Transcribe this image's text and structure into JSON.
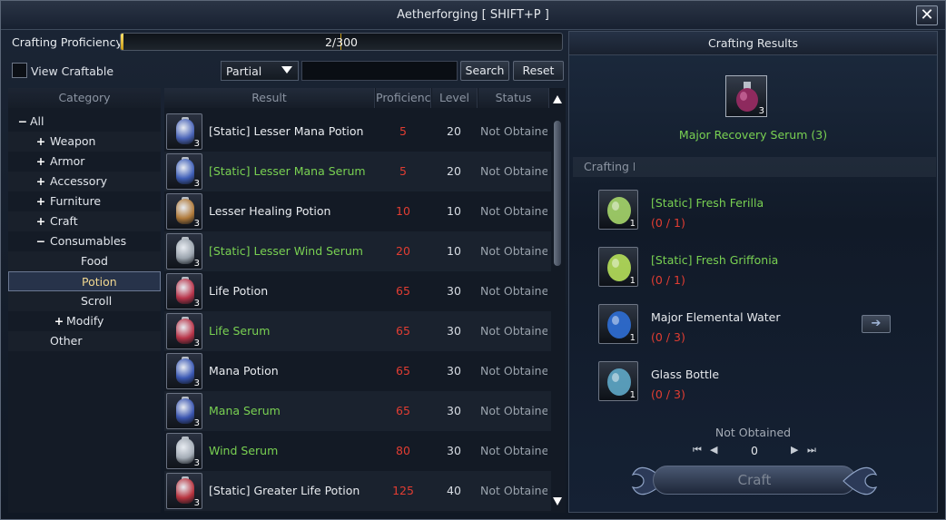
{
  "window": {
    "title": "Aetherforging [ SHIFT+P ]"
  },
  "proficiency": {
    "label": "Crafting Proficiency",
    "text": "2/300",
    "fraction": 0.0067
  },
  "filters": {
    "view_craftable_label": "View Craftable",
    "match_mode": "Partial",
    "search_placeholder": "",
    "search_button": "Search",
    "reset_button": "Reset"
  },
  "category": {
    "header": "Category",
    "items": [
      {
        "label": "All",
        "sign": "−"
      },
      {
        "label": "Weapon",
        "sign": "+"
      },
      {
        "label": "Armor",
        "sign": "+"
      },
      {
        "label": "Accessory",
        "sign": "+"
      },
      {
        "label": "Furniture",
        "sign": "+"
      },
      {
        "label": "Craft",
        "sign": "+"
      },
      {
        "label": "Consumables",
        "sign": "−"
      },
      {
        "label": "Food",
        "sign": ""
      },
      {
        "label": "Potion",
        "sign": ""
      },
      {
        "label": "Scroll",
        "sign": ""
      },
      {
        "label": "Modify",
        "sign": "+"
      },
      {
        "label": "Other",
        "sign": ""
      }
    ]
  },
  "list": {
    "headers": {
      "result": "Result",
      "proficiency": "Proficiency",
      "level": "Level",
      "status": "Status"
    },
    "rows": [
      {
        "name": "[Static] Lesser Mana Potion",
        "color": "white",
        "proficiency": "5",
        "level": "20",
        "status": "Not Obtained",
        "qty": "3",
        "potion": "#4a64b8"
      },
      {
        "name": "[Static] Lesser Mana Serum",
        "color": "green",
        "proficiency": "5",
        "level": "20",
        "status": "Not Obtained",
        "qty": "3",
        "potion": "#3f5fb8"
      },
      {
        "name": "Lesser Healing Potion",
        "color": "white",
        "proficiency": "10",
        "level": "10",
        "status": "Not Obtained",
        "qty": "3",
        "potion": "#b07a3a"
      },
      {
        "name": "[Static] Lesser Wind Serum",
        "color": "green",
        "proficiency": "20",
        "level": "10",
        "status": "Not Obtained",
        "qty": "3",
        "potion": "#9aa3ad"
      },
      {
        "name": "Life Potion",
        "color": "white",
        "proficiency": "65",
        "level": "30",
        "status": "Not Obtained",
        "qty": "3",
        "potion": "#b8344a"
      },
      {
        "name": "Life Serum",
        "color": "green",
        "proficiency": "65",
        "level": "30",
        "status": "Not Obtained",
        "qty": "3",
        "potion": "#b83448"
      },
      {
        "name": "Mana Potion",
        "color": "white",
        "proficiency": "65",
        "level": "30",
        "status": "Not Obtained",
        "qty": "3",
        "potion": "#3a58b4"
      },
      {
        "name": "Mana Serum",
        "color": "green",
        "proficiency": "65",
        "level": "30",
        "status": "Not Obtained",
        "qty": "3",
        "potion": "#3a55b0"
      },
      {
        "name": "Wind Serum",
        "color": "green",
        "proficiency": "80",
        "level": "30",
        "status": "Not Obtained",
        "qty": "3",
        "potion": "#a4acb6"
      },
      {
        "name": "[Static] Greater Life Potion",
        "color": "white",
        "proficiency": "125",
        "level": "40",
        "status": "Not Obtained",
        "qty": "3",
        "potion": "#b8343f"
      }
    ]
  },
  "results": {
    "title": "Crafting Results",
    "item_name": "Major Recovery Serum (3)",
    "item_qty": "3",
    "materials_header": "Crafting Materials",
    "materials": [
      {
        "name": "[Static] Fresh Ferilla",
        "color": "green",
        "count": "(0 / 1)",
        "qty": "1",
        "icon": "herb-icon",
        "tint": "#a6d66a"
      },
      {
        "name": "[Static] Fresh Griffonia",
        "color": "green",
        "count": "(0 / 1)",
        "qty": "1",
        "icon": "leaf-icon",
        "tint": "#b6e05a"
      },
      {
        "name": "Major Elemental Water",
        "color": "white",
        "count": "(0 / 3)",
        "qty": "1",
        "icon": "water-flask-icon",
        "tint": "#2f6fd6"
      },
      {
        "name": "Glass Bottle",
        "color": "white",
        "count": "(0 / 3)",
        "qty": "1",
        "icon": "glass-bottle-icon",
        "tint": "#5fa8c8"
      }
    ],
    "status": "Not Obtained",
    "craft_count": "0",
    "craft_button": "Craft"
  }
}
